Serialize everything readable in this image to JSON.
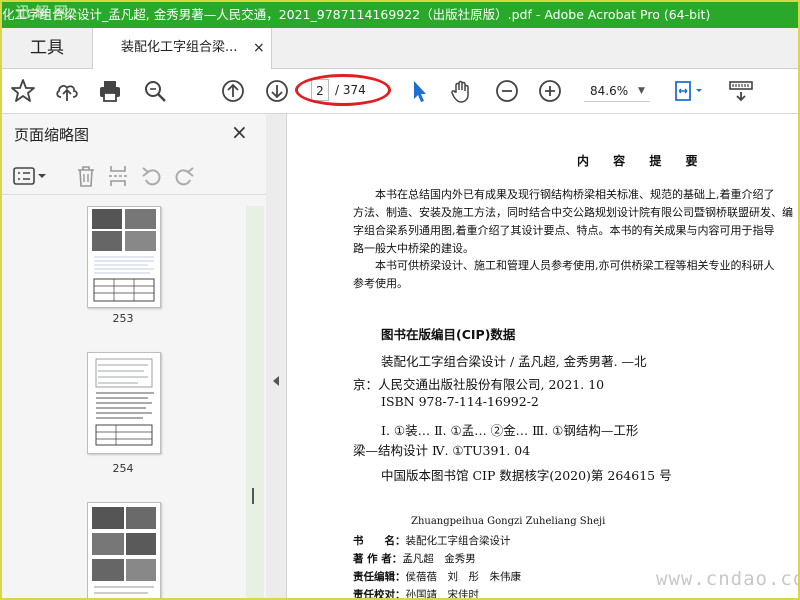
{
  "window": {
    "title": "化工字组合梁设计_孟凡超, 金秀男著—人民交通，2021_9787114169922（出版社原版）.pdf - Adobe Acrobat Pro (64-bit)",
    "watermark_top": "迅 解 网"
  },
  "tabs": {
    "tools": "工具",
    "document": "装配化工字组合梁...",
    "close": "×"
  },
  "toolbar": {
    "page_current": "2",
    "page_total": "/ 374",
    "zoom": "84.6%",
    "icons": [
      "star-icon",
      "cloud-upload-icon",
      "print-icon",
      "zoom-search-icon",
      "page-up-icon",
      "page-down-icon",
      "select-cursor-icon",
      "hand-tool-icon",
      "zoom-out-icon",
      "zoom-in-icon",
      "fit-page-icon",
      "more-tools-icon"
    ]
  },
  "sidebar": {
    "title": "页面缩略图",
    "close": "×",
    "thumbnails": [
      {
        "label": "253"
      },
      {
        "label": "254"
      },
      {
        "label": ""
      }
    ]
  },
  "page": {
    "title": "内 容 提 要",
    "summary": [
      "本书在总结国内外已有成果及现行钢结构桥梁相关标准、规范的基础上,着重介绍了",
      "方法、制造、安装及施工方法，同时结合中交公路规划设计院有限公司暨钢桥联盟研发、编",
      "字组合梁系列通用图,着重介绍了其设计要点、特点。本书的有关成果与内容可用于指导",
      "路一般大中桥梁的建设。",
      "本书可供桥梁设计、施工和管理人员参考使用,亦可供桥梁工程等相关专业的科研人",
      "参考使用。"
    ],
    "cip_heading": "图书在版编目(CIP)数据",
    "cip_lines": [
      "装配化工字组合梁设计 / 孟凡超, 金秀男著. —北",
      "京：人民交通出版社股份有限公司, 2021. 10",
      "ISBN  978-7-114-16992-2",
      "Ⅰ. ①装…  Ⅱ. ①孟… ②金…  Ⅲ. ①钢结构—工形",
      "梁—结构设计  Ⅳ. ①TU391. 04",
      "中国版本图书馆 CIP 数据核字(2020)第 264615 号"
    ],
    "pinyin": "Zhuangpeihua Gongzi Zuheliang Sheji",
    "meta": [
      {
        "key": "书　　名：",
        "value": "装配化工字组合梁设计"
      },
      {
        "key": "著 作 者：",
        "value": "孟凡超　金秀男"
      },
      {
        "key": "责任编辑：",
        "value": "侯蓓蓓　刘　彤　朱伟康"
      },
      {
        "key": "责任校对：",
        "value": "孙国靖　宋佳时"
      }
    ]
  },
  "watermark_bottom": "www.cndao.com"
}
